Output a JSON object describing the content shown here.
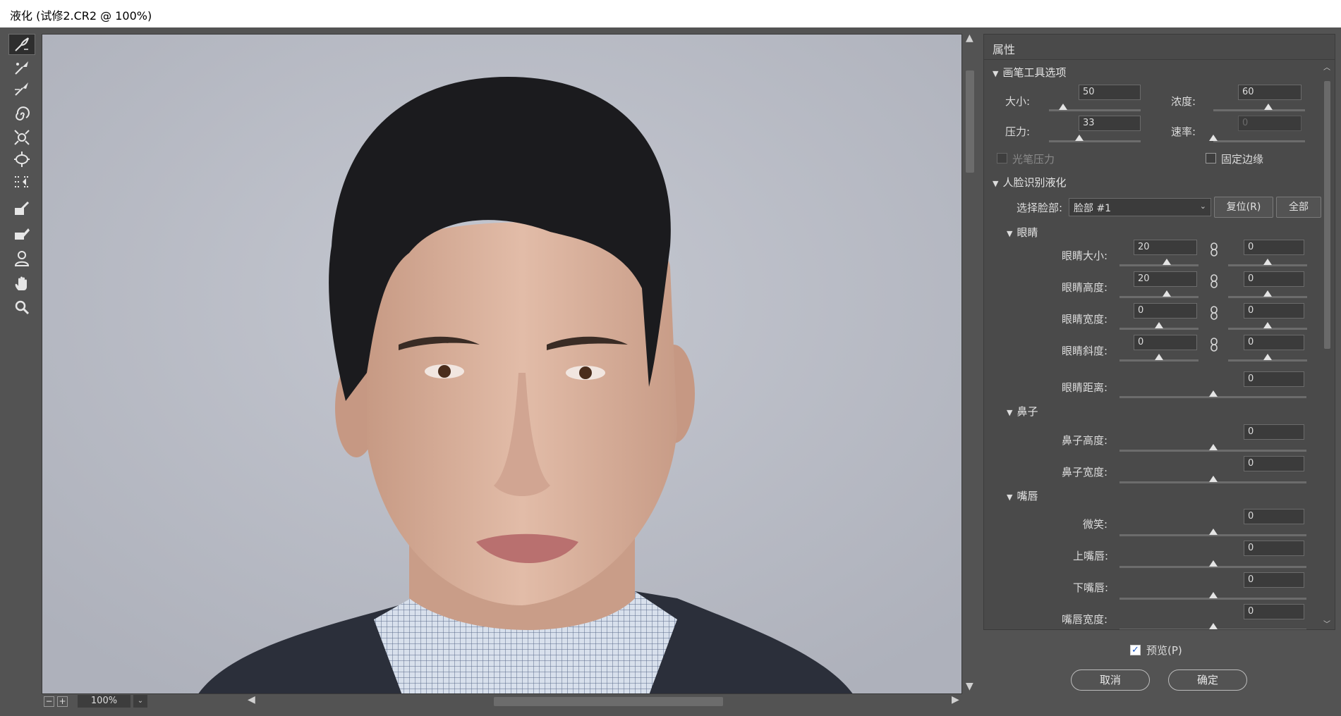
{
  "window": {
    "title": "液化 (试修2.CR2 @ 100%)"
  },
  "toolbar": {
    "tools": [
      "forward-warp-tool",
      "reconstruct-tool",
      "smooth-tool",
      "twirl-tool",
      "pucker-tool",
      "bloat-tool",
      "push-left-tool",
      "freeze-mask-tool",
      "thaw-mask-tool",
      "face-tool",
      "hand-tool",
      "zoom-tool"
    ]
  },
  "canvas": {
    "zoom": "100%"
  },
  "panel": {
    "title": "属性",
    "brush": {
      "heading": "画笔工具选项",
      "size_label": "大小:",
      "size": "50",
      "size_pct": 0.15,
      "density_label": "浓度:",
      "density": "60",
      "density_pct": 0.6,
      "pressure_label": "压力:",
      "pressure": "33",
      "pressure_pct": 0.33,
      "rate_label": "速率:",
      "rate": "0",
      "rate_pct": 0.0,
      "stylus_label": "光笔压力",
      "pin_edges_label": "固定边缘"
    },
    "face": {
      "heading": "人脸识别液化",
      "select_label": "选择脸部:",
      "select_value": "脸部 #1",
      "reset_label": "复位(R)",
      "all_label": "全部",
      "eyes": {
        "heading": "眼睛",
        "rows": [
          {
            "label": "眼睛大小:",
            "left": "20",
            "right": "0",
            "lpct": 0.6,
            "rpct": 0.5
          },
          {
            "label": "眼睛高度:",
            "left": "20",
            "right": "0",
            "lpct": 0.6,
            "rpct": 0.5
          },
          {
            "label": "眼睛宽度:",
            "left": "0",
            "right": "0",
            "lpct": 0.5,
            "rpct": 0.5
          },
          {
            "label": "眼睛斜度:",
            "left": "0",
            "right": "0",
            "lpct": 0.5,
            "rpct": 0.5
          }
        ],
        "distance_label": "眼睛距离:",
        "distance": "0"
      },
      "nose": {
        "heading": "鼻子",
        "height_label": "鼻子高度:",
        "height": "0",
        "width_label": "鼻子宽度:",
        "width": "0"
      },
      "mouth": {
        "heading": "嘴唇",
        "smile_label": "微笑:",
        "smile": "0",
        "upper_label": "上嘴唇:",
        "upper": "0",
        "lower_label": "下嘴唇:",
        "lower": "0",
        "width_label": "嘴唇宽度:",
        "width": "0"
      }
    }
  },
  "footer": {
    "preview_label": "预览(P)",
    "cancel_label": "取消",
    "ok_label": "确定"
  }
}
